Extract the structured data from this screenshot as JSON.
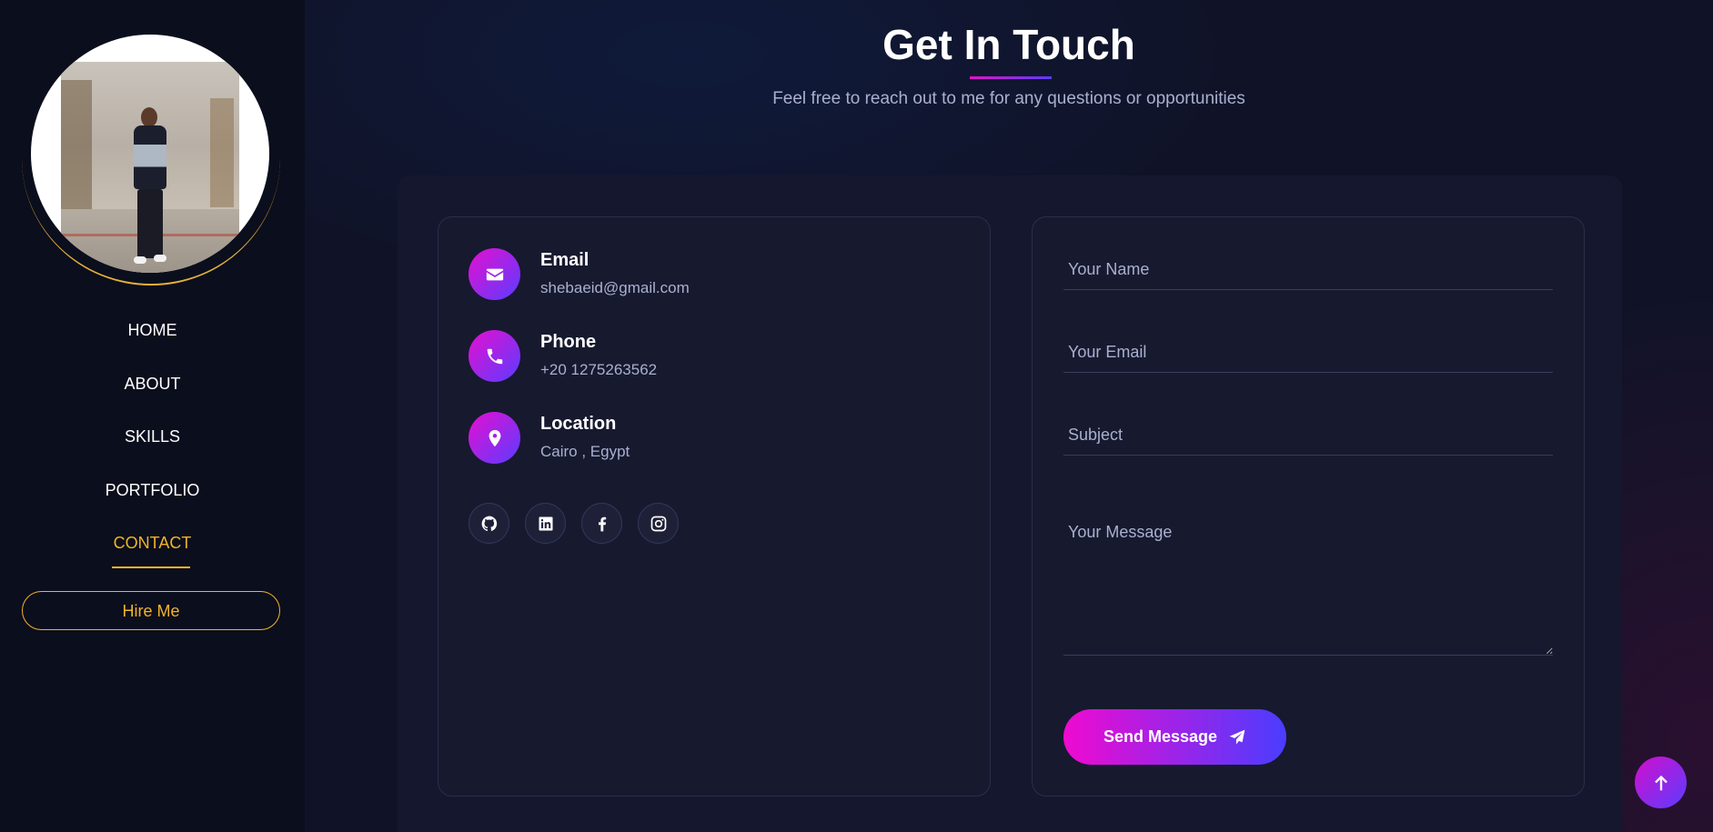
{
  "sidebar": {
    "nav": [
      "HOME",
      "ABOUT",
      "SKILLS",
      "PORTFOLIO",
      "CONTACT"
    ],
    "active": "CONTACT",
    "hire_label": "Hire Me"
  },
  "header": {
    "title": "Get In Touch",
    "subtitle": "Feel free to reach out to me for any questions or opportunities"
  },
  "contact_info": {
    "email_label": "Email",
    "email_value": "shebaeid@gmail.com",
    "phone_label": "Phone",
    "phone_value": "+20 1275263562",
    "location_label": "Location",
    "location_value": "Cairo , Egypt",
    "socials": [
      "github-icon",
      "linkedin-icon",
      "facebook-icon",
      "instagram-icon"
    ]
  },
  "form": {
    "name_placeholder": "Your Name",
    "email_placeholder": "Your Email",
    "subject_placeholder": "Subject",
    "message_placeholder": "Your Message",
    "send_label": "Send Message"
  },
  "colors": {
    "accent_gold": "#f0b429",
    "gradient_start": "#e60fd0",
    "gradient_end": "#5a3cff",
    "background": "#101328"
  }
}
